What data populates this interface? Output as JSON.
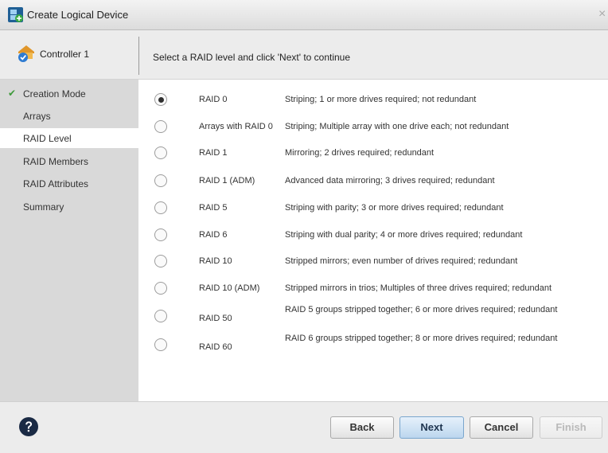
{
  "window": {
    "title": "Create Logical Device",
    "close_glyph": "×",
    "title_icon": "logical-device-add-icon"
  },
  "header": {
    "controller_name": "Controller 1",
    "controller_icon": "controller-icon",
    "instruction": "Select a RAID level and click 'Next' to continue"
  },
  "sidebar": {
    "steps": [
      {
        "label": "Creation Mode",
        "completed": true
      },
      {
        "label": "Arrays",
        "completed": false
      },
      {
        "label": "RAID Level",
        "completed": false,
        "active": true
      },
      {
        "label": "RAID Members",
        "completed": false
      },
      {
        "label": "RAID Attributes",
        "completed": false
      },
      {
        "label": "Summary",
        "completed": false
      }
    ]
  },
  "raid_options": [
    {
      "name": "RAID 0",
      "description": "Striping; 1 or more drives required; not redundant",
      "selected": true
    },
    {
      "name": "Arrays with RAID 0",
      "description": "Striping; Multiple array with one drive each; not redundant",
      "selected": false
    },
    {
      "name": "RAID 1",
      "description": "Mirroring; 2 drives required; redundant",
      "selected": false
    },
    {
      "name": "RAID 1 (ADM)",
      "description": "Advanced data mirroring; 3 drives required; redundant",
      "selected": false
    },
    {
      "name": "RAID 5",
      "description": "Striping with parity; 3 or more drives required; redundant",
      "selected": false
    },
    {
      "name": "RAID 6",
      "description": "Striping with dual parity; 4 or more drives required; redundant",
      "selected": false
    },
    {
      "name": "RAID 10",
      "description": "Stripped mirrors; even number of drives required; redundant",
      "selected": false
    },
    {
      "name": "RAID 10 (ADM)",
      "description": "Stripped mirrors in trios; Multiples of three drives required; redundant",
      "selected": false
    },
    {
      "name": "RAID 50",
      "description": "RAID 5 groups stripped together; 6 or more drives required; redundant",
      "selected": false
    },
    {
      "name": "RAID 60",
      "description": "RAID 6 groups stripped together; 8 or more drives required; redundant",
      "selected": false
    }
  ],
  "footer": {
    "help_icon": "help-icon",
    "back_label": "Back",
    "next_label": "Next",
    "cancel_label": "Cancel",
    "finish_label": "Finish"
  },
  "colors": {
    "check": "#3d9a3a",
    "next_button": "#bcd6ee",
    "sidebar_bg": "#d9d9d9"
  }
}
